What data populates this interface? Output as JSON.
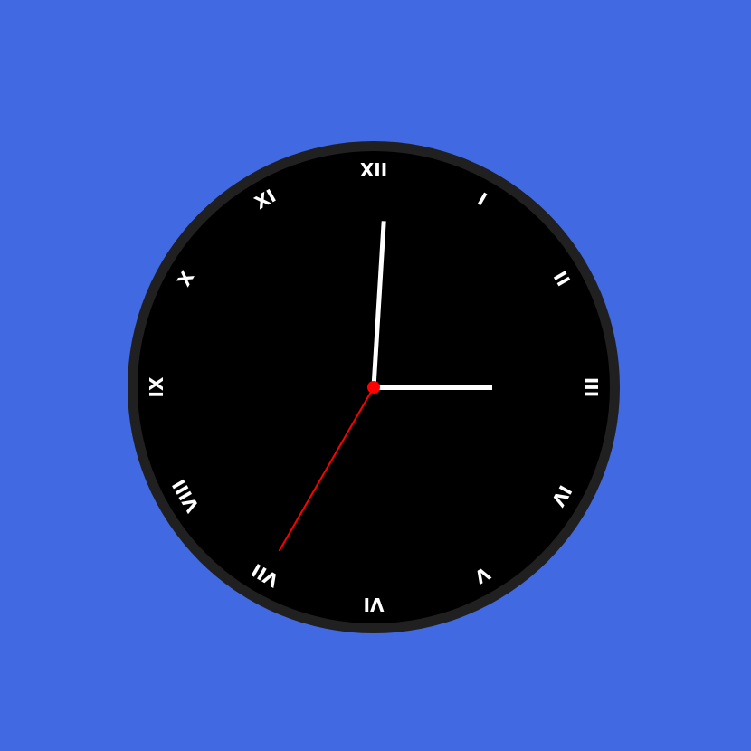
{
  "clock": {
    "time": {
      "hour": 3,
      "minute": 0,
      "second": 35
    },
    "numerals": [
      "XII",
      "I",
      "II",
      "III",
      "IV",
      "V",
      "VI",
      "VII",
      "VIII",
      "IX",
      "X",
      "XI"
    ],
    "colors": {
      "background": "#4169e1",
      "face": "#000000",
      "rim": "#202020",
      "numerals": "#ffffff",
      "hour_hand": "#ffffff",
      "minute_hand": "#ffffff",
      "second_hand": "#ff0000",
      "center_pin": "#ff0000"
    }
  }
}
